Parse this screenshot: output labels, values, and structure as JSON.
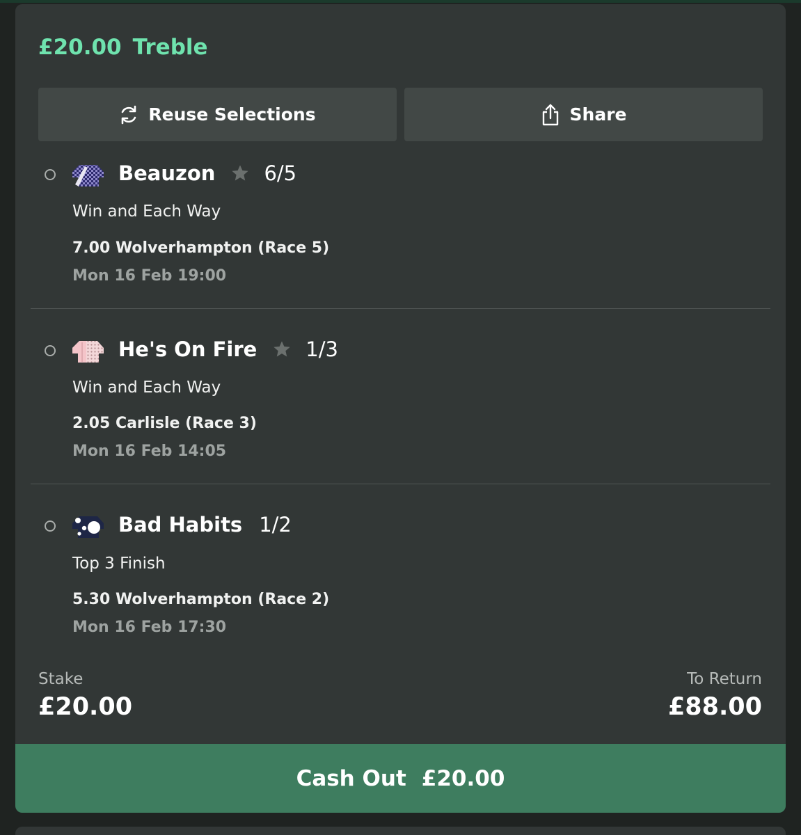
{
  "bet": {
    "stake_header": "£20.00",
    "type": "Treble"
  },
  "actions": {
    "reuse_label": "Reuse Selections",
    "share_label": "Share"
  },
  "selections": [
    {
      "horse": "Beauzon",
      "odds": "6/5",
      "has_star": true,
      "market": "Win and Each Way",
      "race": "7.00 Wolverhampton (Race 5)",
      "time": "Mon 16 Feb 19:00"
    },
    {
      "horse": "He's On Fire",
      "odds": "1/3",
      "has_star": true,
      "market": "Win and Each Way",
      "race": "2.05 Carlisle (Race 3)",
      "time": "Mon 16 Feb 14:05"
    },
    {
      "horse": "Bad Habits",
      "odds": "1/2",
      "has_star": false,
      "market": "Top 3 Finish",
      "race": "5.30 Wolverhampton (Race 2)",
      "time": "Mon 16 Feb 17:30"
    }
  ],
  "summary": {
    "stake_label": "Stake",
    "stake_value": "£20.00",
    "return_label": "To Return",
    "return_value": "£88.00"
  },
  "cashout": {
    "label": "Cash Out",
    "amount": "£20.00"
  },
  "colors": {
    "accent_green": "#6fe3ae",
    "cashout_green": "#3e7d5f",
    "card_bg": "#323736",
    "button_bg": "#424846"
  }
}
